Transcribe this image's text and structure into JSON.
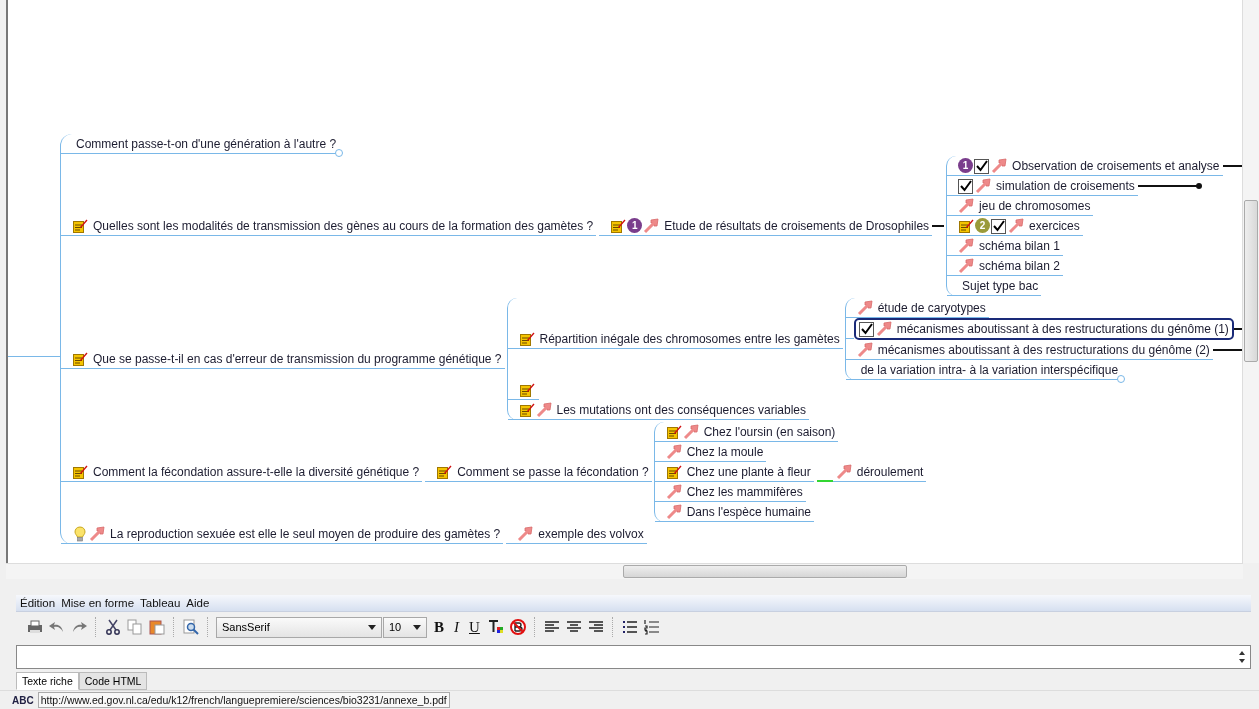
{
  "map": {
    "branches": [
      {
        "text": "Comment passe-t-on d'une génération à l'autre ?",
        "selected": false,
        "folded": true
      },
      {
        "text": "Quelles sont les modalités de transmission des gènes au cours de la formation des gamètes ?",
        "icons": [
          {
            "kind": "note"
          }
        ],
        "selected": false,
        "children": [
          {
            "text": "Etude de résultats de croisements de Drosophiles",
            "icons": [
              {
                "kind": "note"
              },
              {
                "kind": "priority",
                "label": "1",
                "color": "#7a3d8c"
              },
              {
                "kind": "link"
              }
            ],
            "selected": false,
            "link_out": true,
            "children": [
              {
                "text": "Observation de croisements et analyse",
                "icons": [
                  {
                    "kind": "priority",
                    "label": "1",
                    "color": "#7a3d8c"
                  },
                  {
                    "kind": "check"
                  },
                  {
                    "kind": "link"
                  }
                ],
                "selected": false,
                "link_out": true
              },
              {
                "text": "simulation de croisements",
                "icons": [
                  {
                    "kind": "check"
                  },
                  {
                    "kind": "link"
                  }
                ],
                "selected": false,
                "link_out": true,
                "link_dot": true
              },
              {
                "text": "jeu de chromosomes",
                "icons": [
                  {
                    "kind": "link"
                  }
                ],
                "selected": false
              },
              {
                "text": "exercices",
                "icons": [
                  {
                    "kind": "note"
                  },
                  {
                    "kind": "priority",
                    "label": "2",
                    "color": "#9a9a3a"
                  },
                  {
                    "kind": "check"
                  },
                  {
                    "kind": "link"
                  }
                ],
                "selected": false
              },
              {
                "text": "schéma bilan 1",
                "icons": [
                  {
                    "kind": "link"
                  }
                ],
                "selected": false
              },
              {
                "text": "schéma bilan 2",
                "icons": [
                  {
                    "kind": "link"
                  }
                ],
                "selected": false
              },
              {
                "text": "Sujet type bac",
                "selected": false
              }
            ]
          }
        ]
      },
      {
        "text": "Que se passe-t-il en cas d'erreur de transmission du programme génétique ?",
        "icons": [
          {
            "kind": "note"
          }
        ],
        "selected": false,
        "children": [
          {
            "text": "Répartition inégale des chromosomes entre les gamètes",
            "icons": [
              {
                "kind": "note"
              }
            ],
            "selected": false,
            "children": [
              {
                "text": "étude de caryotypes",
                "icons": [
                  {
                    "kind": "link"
                  }
                ],
                "selected": false
              },
              {
                "text": "mécanismes aboutissant à des restructurations du génôme (1)",
                "icons": [
                  {
                    "kind": "check"
                  },
                  {
                    "kind": "link"
                  }
                ],
                "selected": true,
                "link_out": true
              },
              {
                "text": "mécanismes aboutissant à des restructurations du génôme (2)",
                "icons": [
                  {
                    "kind": "link"
                  }
                ],
                "selected": false,
                "link_out": true
              },
              {
                "text": "de la variation intra- à la variation interspécifique",
                "selected": false,
                "folded": true
              }
            ]
          },
          {
            "icons": [
              {
                "kind": "note"
              }
            ],
            "selected": false
          },
          {
            "text": "Les mutations ont des conséquences variables",
            "icons": [
              {
                "kind": "note"
              },
              {
                "kind": "link"
              }
            ],
            "selected": false
          }
        ]
      },
      {
        "text": "Comment la fécondation assure-t-elle la diversité génétique ?",
        "icons": [
          {
            "kind": "note"
          }
        ],
        "selected": false,
        "children": [
          {
            "text": "Comment se passe la fécondation ?",
            "icons": [
              {
                "kind": "note"
              }
            ],
            "selected": false,
            "children": [
              {
                "text": "Chez l'oursin (en saison)",
                "icons": [
                  {
                    "kind": "note"
                  },
                  {
                    "kind": "link"
                  }
                ],
                "selected": false
              },
              {
                "text": "Chez la moule",
                "icons": [
                  {
                    "kind": "link"
                  }
                ],
                "selected": false
              },
              {
                "text": "Chez une plante à fleur",
                "icons": [
                  {
                    "kind": "note"
                  }
                ],
                "selected": false,
                "children": [
                  {
                    "text": "déroulement",
                    "icons": [
                      {
                        "kind": "link"
                      }
                    ],
                    "selected": false,
                    "color": "#33d633"
                  }
                ]
              },
              {
                "text": "Chez les mammifères",
                "icons": [
                  {
                    "kind": "link"
                  }
                ],
                "selected": false
              },
              {
                "text": "Dans l'espèce humaine",
                "icons": [
                  {
                    "kind": "link"
                  }
                ],
                "selected": false
              }
            ]
          }
        ]
      },
      {
        "text": "La reproduction sexuée est elle le seul moyen de produire des gamètes ?",
        "icons": [
          {
            "kind": "idea"
          },
          {
            "kind": "link"
          }
        ],
        "selected": false,
        "children": [
          {
            "text": "exemple des volvox",
            "icons": [
              {
                "kind": "link"
              }
            ],
            "selected": false
          }
        ]
      }
    ]
  },
  "editor": {
    "menu": [
      "Édition",
      "Mise en forme",
      "Tableau",
      "Aide"
    ],
    "toolbar": [
      {
        "kind": "print"
      },
      {
        "kind": "undo"
      },
      {
        "kind": "redo"
      },
      {
        "kind": "sep"
      },
      {
        "kind": "cut"
      },
      {
        "kind": "copy"
      },
      {
        "kind": "paste"
      },
      {
        "kind": "sep"
      },
      {
        "kind": "find"
      },
      {
        "kind": "sep"
      },
      {
        "kind": "font",
        "value": "SansSerif"
      },
      {
        "kind": "size",
        "value": "10"
      },
      {
        "kind": "bold",
        "label": "B"
      },
      {
        "kind": "italic",
        "label": "I"
      },
      {
        "kind": "underline",
        "label": "U"
      },
      {
        "kind": "color"
      },
      {
        "kind": "clear"
      },
      {
        "kind": "sep"
      },
      {
        "kind": "align-left"
      },
      {
        "kind": "align-center"
      },
      {
        "kind": "align-right"
      },
      {
        "kind": "sep"
      },
      {
        "kind": "bullets"
      },
      {
        "kind": "numbers"
      }
    ],
    "tabs": [
      {
        "label": "Texte riche",
        "selected": true
      },
      {
        "label": "Code HTML",
        "selected": false
      }
    ]
  },
  "status_bar": {
    "spell": "ABC",
    "url": "http://www.ed.gov.nl.ca/edu/k12/french/languepremiere/sciences/bio3231/annexe_b.pdf"
  }
}
